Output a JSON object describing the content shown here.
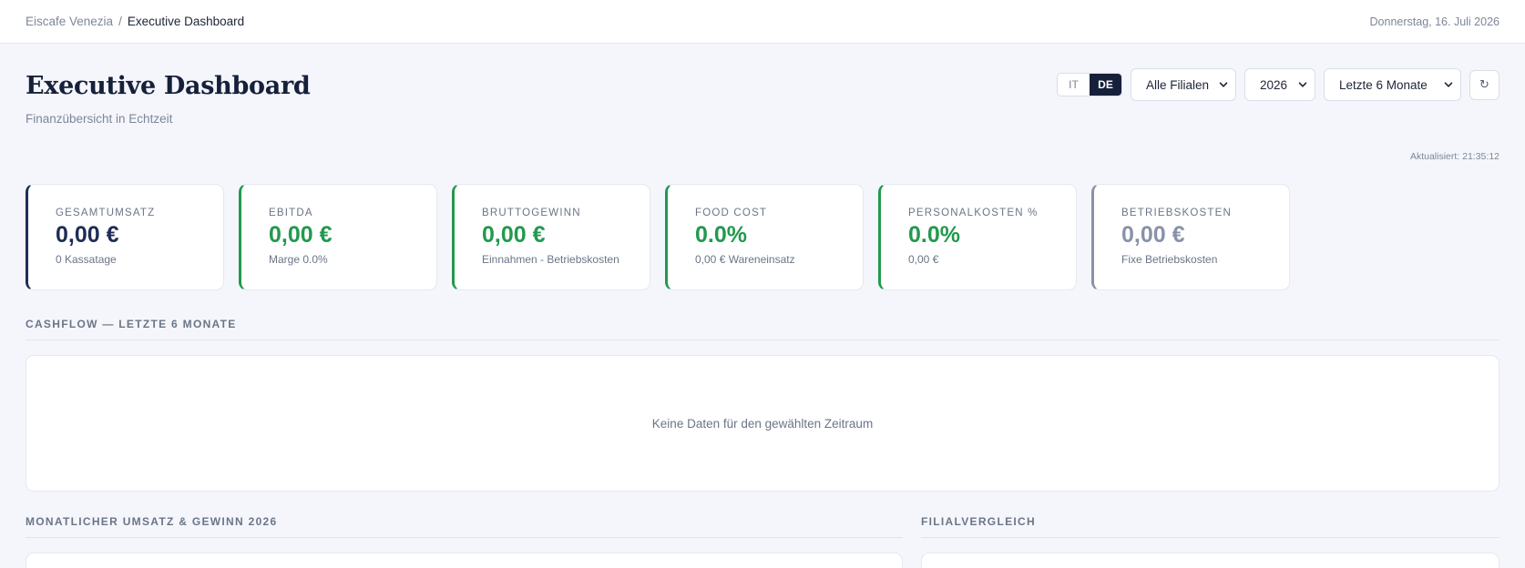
{
  "breadcrumb": {
    "home": "Eiscafe Venezia",
    "separator": "/",
    "current": "Executive Dashboard"
  },
  "header_date": "Donnerstag, 16. Juli 2026",
  "page": {
    "title": "Executive Dashboard",
    "subtitle": "Finanzübersicht in Echtzeit",
    "updated": "Aktualisiert: 21:35:12"
  },
  "controls": {
    "lang_it": "IT",
    "lang_de": "DE",
    "active_lang": "DE",
    "branch": "Alle Filialen",
    "year": "2026",
    "period": "Letzte 6 Monate",
    "refresh_icon": "refresh-icon"
  },
  "kpis": [
    {
      "label": "Gesamtumsatz",
      "value": "0,00 €",
      "sub": "0 Kassatage",
      "color": "#1e2d55"
    },
    {
      "label": "EBITDA",
      "value": "0,00 €",
      "sub": "Marge 0.0%",
      "color": "#22994d"
    },
    {
      "label": "Bruttogewinn",
      "value": "0,00 €",
      "sub": "Einnahmen - Betriebskosten",
      "color": "#22994d"
    },
    {
      "label": "Food Cost",
      "value": "0.0%",
      "sub": "0,00 € Wareneinsatz",
      "color": "#22994d"
    },
    {
      "label": "Personalkosten %",
      "value": "0.0%",
      "sub": "0,00 €",
      "color": "#22994d"
    },
    {
      "label": "Betriebskosten",
      "value": "0,00 €",
      "sub": "Fixe Betriebskosten",
      "color": "#8892a8"
    }
  ],
  "sections": {
    "cashflow_title": "Cashflow — Letzte 6 Monate",
    "cashflow_empty": "Keine Daten für den gewählten Zeitraum",
    "monthly_title": "Monatlicher Umsatz & Gewinn 2026",
    "branch_compare_title": "Filialvergleich"
  }
}
